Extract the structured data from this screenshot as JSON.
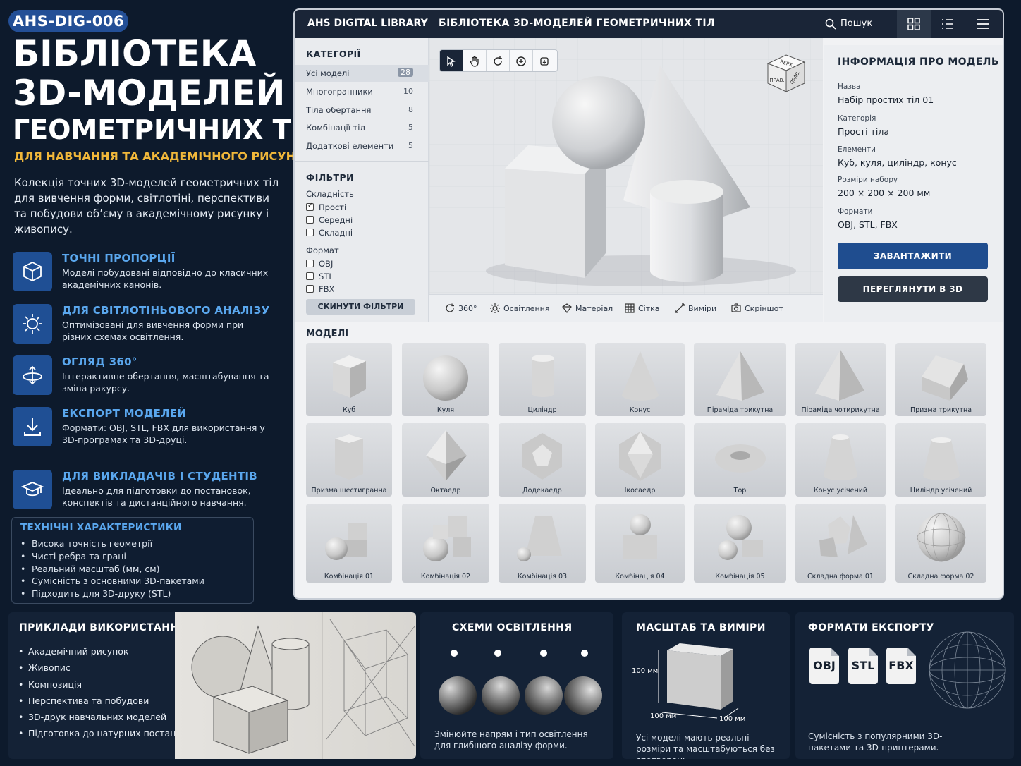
{
  "badge": "AHS-DIG-006",
  "title": {
    "line1": "БІБЛІОТЕКА",
    "line2": "3D-МОДЕЛЕЙ",
    "line3": "ГЕОМЕТРИЧНИХ ТІЛ"
  },
  "subtitle": "ДЛЯ НАВЧАННЯ ТА АКАДЕМІЧНОГО РИСУНКА",
  "description": "Колекція точних 3D-моделей геометричних тіл для вивчення форми, світлотіні, перспективи та побудови об’єму в академічному рисунку і живопису.",
  "features": [
    {
      "title": "ТОЧНІ ПРОПОРЦІЇ",
      "text": "Моделі побудовані відповідно до класичних академічних канонів.",
      "icon": "cube-icon"
    },
    {
      "title": "ДЛЯ СВІТЛОТІНЬОВОГО АНАЛІЗУ",
      "text": "Оптимізовані для вивчення форми при різних схемах освітлення.",
      "icon": "sun-icon"
    },
    {
      "title": "ОГЛЯД 360°",
      "text": "Інтерактивне обертання, масштабування та зміна ракурсу.",
      "icon": "rotate-360-icon"
    },
    {
      "title": "ЕКСПОРТ МОДЕЛЕЙ",
      "text": "Формати: OBJ, STL, FBX для використання у 3D-програмах та 3D-друці.",
      "icon": "download-icon"
    },
    {
      "title": "ДЛЯ ВИКЛАДАЧІВ І СТУДЕНТІВ",
      "text": "Ідеально для підготовки до постановок, конспектів та дистанційного навчання.",
      "icon": "graduation-cap-icon"
    }
  ],
  "tech": {
    "title": "ТЕХНІЧНІ ХАРАКТЕРИСТИКИ",
    "items": [
      "Висока точність геометрії",
      "Чисті ребра та грані",
      "Реальний масштаб (мм, см)",
      "Сумісність з основними 3D-пакетами",
      "Підходить для 3D-друку (STL)"
    ]
  },
  "app": {
    "brand": "AHS DIGITAL LIBRARY",
    "title": "БІБЛІОТЕКА 3D-МОДЕЛЕЙ ГЕОМЕТРИЧНИХ ТІЛ",
    "search": "Пошук",
    "categories_title": "КАТЕГОРІЇ",
    "categories": [
      {
        "label": "Усі моделі",
        "count": "28"
      },
      {
        "label": "Многогранники",
        "count": "10"
      },
      {
        "label": "Тіла обертання",
        "count": "8"
      },
      {
        "label": "Комбінації тіл",
        "count": "5"
      },
      {
        "label": "Додаткові елементи",
        "count": "5"
      }
    ],
    "filters_title": "ФІЛЬТРИ",
    "complexity_label": "Складність",
    "complexity": [
      {
        "label": "Прості",
        "checked": true
      },
      {
        "label": "Середні",
        "checked": false
      },
      {
        "label": "Складні",
        "checked": false
      }
    ],
    "format_label": "Формат",
    "formats": [
      {
        "label": "OBJ",
        "checked": false
      },
      {
        "label": "STL",
        "checked": false
      },
      {
        "label": "FBX",
        "checked": false
      }
    ],
    "reset": "СКИНУТИ ФІЛЬТРИ",
    "navcube": {
      "top": "ВЕРХ",
      "front": "ПРАВ.",
      "right": "ПРАВ."
    },
    "viewer_bar": [
      "360°",
      "Освітлення",
      "Матеріал",
      "Сітка",
      "Виміри",
      "Скріншот"
    ],
    "info": {
      "title": "ІНФОРМАЦІЯ ПРО МОДЕЛЬ",
      "fields": [
        {
          "label": "Назва",
          "value": "Набір простих тіл 01"
        },
        {
          "label": "Категорія",
          "value": "Прості тіла"
        },
        {
          "label": "Елементи",
          "value": "Куб, куля, циліндр, конус"
        },
        {
          "label": "Розміри набору",
          "value": "200 × 200 × 200 мм"
        },
        {
          "label": "Формати",
          "value": "OBJ, STL, FBX"
        }
      ],
      "download": "ЗАВАНТАЖИТИ",
      "view3d": "ПЕРЕГЛЯНУТИ В 3D"
    },
    "models_title": "МОДЕЛІ",
    "models": [
      "Куб",
      "Куля",
      "Циліндр",
      "Конус",
      "Піраміда трикутна",
      "Піраміда чотирикутна",
      "Призма трикутна",
      "Призма шестигранна",
      "Октаедр",
      "Додекаедр",
      "Ікосаедр",
      "Тор",
      "Конус усічений",
      "Циліндр усічений",
      "Комбінація 01",
      "Комбінація 02",
      "Комбінація 03",
      "Комбінація 04",
      "Комбінація 05",
      "Складна форма 01",
      "Складна форма 02"
    ]
  },
  "usage": {
    "title": "ПРИКЛАДИ ВИКОРИСТАННЯ",
    "items": [
      "Академічний рисунок",
      "Живопис",
      "Композиція",
      "Перспектива та побудови",
      "3D-друк навчальних моделей",
      "Підготовка до натурних постановок"
    ]
  },
  "lighting": {
    "title": "СХЕМИ ОСВІТЛЕННЯ",
    "text": "Змінюйте напрям і тип освітлення для глибшого аналізу форми."
  },
  "scale": {
    "title": "МАСШТАБ ТА ВИМІРИ",
    "dim_h": "100 мм",
    "dim_w": "100 мм",
    "dim_d": "100 мм",
    "text": "Усі моделі мають реальні розміри та масштабуються без спотворень."
  },
  "export": {
    "title": "ФОРМАТИ ЕКСПОРТУ",
    "formats": [
      "OBJ",
      "STL",
      "FBX"
    ],
    "text": "Сумісність з популярними 3D-пакетами та 3D-принтерами."
  }
}
